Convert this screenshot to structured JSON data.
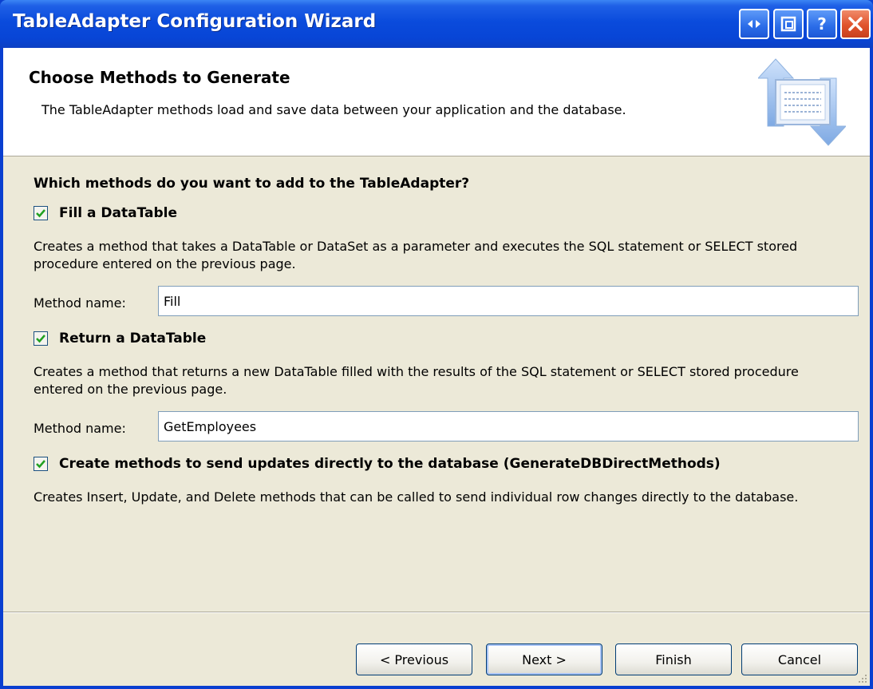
{
  "window": {
    "title": "TableAdapter Configuration Wizard",
    "controls": [
      "restore-icon",
      "maximize-icon",
      "help-icon",
      "close-icon"
    ],
    "titlebar_color": "#0a4bdc",
    "close_color": "#e0532c"
  },
  "header": {
    "title": "Choose Methods to Generate",
    "description": "The TableAdapter methods load and save data between your application and the database."
  },
  "question": "Which methods do you want to add to the TableAdapter?",
  "options": [
    {
      "label": "Fill a DataTable",
      "checked": true,
      "description": "Creates a method that takes a DataTable or DataSet as a parameter and executes the SQL statement or SELECT stored procedure entered on the previous page.",
      "method_label": "Method name:",
      "method_value": "Fill"
    },
    {
      "label": "Return a DataTable",
      "checked": true,
      "description": "Creates a method that returns a new DataTable filled with the results of the SQL statement or SELECT stored procedure entered on the previous page.",
      "method_label": "Method name:",
      "method_value": "GetEmployees"
    },
    {
      "label": "Create methods to send updates directly to the database (GenerateDBDirectMethods)",
      "checked": true,
      "description": "Creates Insert, Update, and Delete methods that can be called to send individual row changes directly to the database."
    }
  ],
  "buttons": {
    "previous": "< Previous",
    "next": "Next >",
    "finish": "Finish",
    "cancel": "Cancel"
  },
  "colors": {
    "dialog_background": "#ece9d8",
    "header_background": "#ffffff",
    "check_color": "#21a121"
  }
}
